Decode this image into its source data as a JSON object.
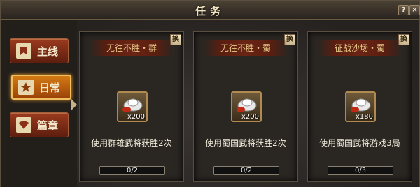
{
  "window": {
    "title": "任务",
    "help_label": "?",
    "close_label": "×"
  },
  "sidebar": {
    "items": [
      {
        "label": "主线",
        "icon": "banner-icon",
        "active": false
      },
      {
        "label": "日常",
        "icon": "star-icon",
        "active": true
      },
      {
        "label": "篇章",
        "icon": "fan-icon",
        "active": false
      }
    ]
  },
  "tasks": [
    {
      "title": "无往不胜・群",
      "swap_label": "换",
      "reward_count": "x200",
      "description": "使用群雄武将获胜2次",
      "progress_text": "0/2",
      "progress": 0
    },
    {
      "title": "无往不胜・蜀",
      "swap_label": "换",
      "reward_count": "x200",
      "description": "使用蜀国武将获胜2次",
      "progress_text": "0/2",
      "progress": 0
    },
    {
      "title": "征战沙场・蜀",
      "swap_label": "换",
      "reward_count": "x180",
      "description": "使用蜀国武将游戏3局",
      "progress_text": "0/3",
      "progress": 0
    }
  ]
}
